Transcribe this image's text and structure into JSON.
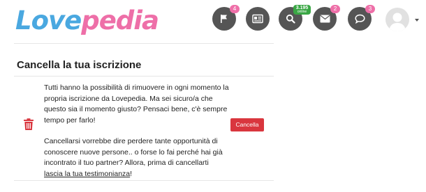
{
  "header": {
    "logo_part1": "Love",
    "logo_part2": "pedia",
    "nav": {
      "flag_badge": "4",
      "online_count": "3.195",
      "online_label": "online",
      "mail_badge": "2",
      "chat_badge": "3"
    },
    "icons": [
      "flag-icon",
      "newspaper-icon",
      "search-icon",
      "envelope-icon",
      "chat-icon",
      "user-avatar",
      "chevron-down-icon"
    ]
  },
  "section": {
    "title": "Cancella la tua iscrizione",
    "paragraph1": "Tutti hanno la possibilità di rimuovere in ogni momento la propria iscrizione da Lovepedia. Ma sei sicuro/a che questo sia il momento giusto? Pensaci bene, c'è sempre tempo per farlo!",
    "paragraph2_text": "Cancellarsi vorrebbe dire perdere tante opportunità di conoscere nuove persone.. o forse lo fai perché hai già incontrato il tuo partner? Allora, prima di cancellarti ",
    "paragraph2_link": "lascia la tua testimonianza",
    "paragraph2_end": "!",
    "cancel_label": "Cancella"
  },
  "colors": {
    "logo_blue": "#4aa8e0",
    "logo_pink": "#ee6fa8",
    "nav_icon_bg": "#555555",
    "badge_pink": "#ee6fa8",
    "online_green": "#3aa745",
    "danger_red": "#d9363e"
  }
}
